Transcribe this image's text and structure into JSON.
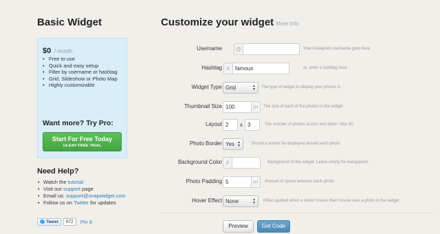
{
  "sidebar": {
    "title": "Basic Widget",
    "plan": {
      "price": "$0",
      "period": "/ month",
      "features": [
        "Free to use",
        "Quick and easy setup",
        "Filter by username or hashtag",
        "Grid, Slideshow or Photo Map",
        "Highly customizable"
      ],
      "upsell": "Want more? Try Pro:",
      "cta_label": "Start For Free Today",
      "cta_sub": "14-DAY FREE TRIAL",
      "cta_color": "#4cae4a"
    },
    "help": {
      "title": "Need Help?",
      "items": [
        {
          "pre": "Watch the ",
          "link": "tutorial",
          "post": ""
        },
        {
          "pre": "Visit our ",
          "link": "support",
          "post": " page"
        },
        {
          "pre": "Email us: ",
          "link": "support@snapwidget.com",
          "post": ""
        },
        {
          "pre": "Follow us on ",
          "link": "Twitter",
          "post": " for updates"
        }
      ]
    },
    "social": {
      "tweet_label": "Tweet",
      "tweet_count": "672",
      "pin_label": "Pin It"
    }
  },
  "main": {
    "title": "Customize your widget",
    "more_info": "More Info",
    "form": {
      "username": {
        "label": "Username",
        "prefix": "@",
        "value": "",
        "hint": "Your Instagram username goes here"
      },
      "hashtag": {
        "label": "Hashtag",
        "prefix": "#",
        "value": "famous",
        "hint": "or, enter a hashtag here"
      },
      "widget_type": {
        "label": "Widget Type",
        "value": "Grid",
        "hint": "The type of widget to display your photos in"
      },
      "thumbnail_size": {
        "label": "Thumbnail Size",
        "value": "100",
        "suffix": "px",
        "hint": "The size of each of the photos in the widget"
      },
      "layout": {
        "label": "Layout",
        "cols": "2",
        "times": "x",
        "rows": "3",
        "hint": "The number of photos across and down. Max 60."
      },
      "photo_border": {
        "label": "Photo Border",
        "value": "Yes",
        "hint": "Should a border be displayed around each photo"
      },
      "background_color": {
        "label": "Background Color",
        "prefix": "#",
        "value": "",
        "hint": "Background of the widget. Leave empty for transparent."
      },
      "photo_padding": {
        "label": "Photo Padding",
        "value": "5",
        "suffix": "px",
        "hint": "Amount of space between each photo"
      },
      "hover_effect": {
        "label": "Hover Effect",
        "value": "None",
        "hint": "Effect applied when a visitor hovers their mouse over a photo in the widget"
      }
    },
    "buttons": {
      "preview": "Preview",
      "get_code": "Get Code"
    }
  },
  "colors": {
    "background": "#f1efea",
    "plan_box": "#d8eef8",
    "link": "#2c7bb6",
    "primary_button": "#5a98c2"
  }
}
